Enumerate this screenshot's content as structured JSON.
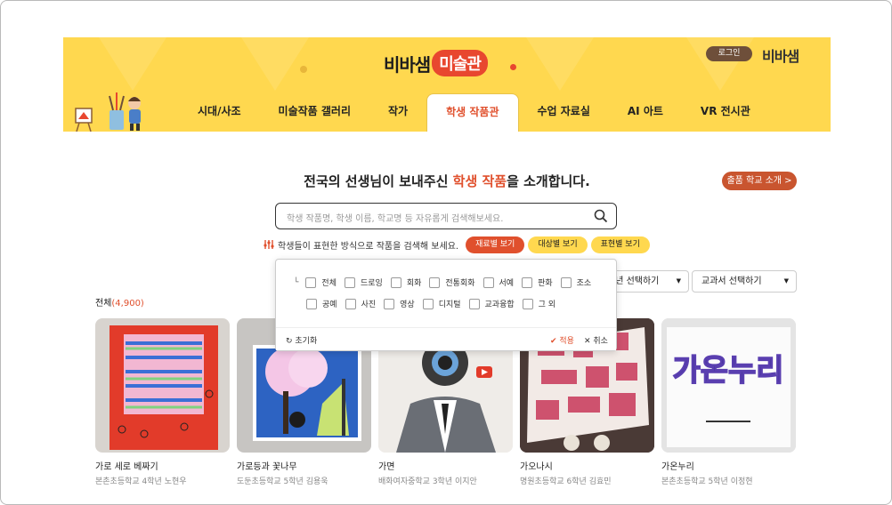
{
  "brand": {
    "logo_text": "비바샘",
    "logo_badge": "미술관",
    "right_logo": "비바샘",
    "login": "로그인"
  },
  "nav": [
    {
      "label": "시대/사조",
      "active": false
    },
    {
      "label": "미술작품 갤러리",
      "active": false
    },
    {
      "label": "작가",
      "active": false
    },
    {
      "label": "학생 작품관",
      "active": true
    },
    {
      "label": "수업 자료실",
      "active": false
    },
    {
      "label": "AI 아트",
      "active": false
    },
    {
      "label": "VR 전시관",
      "active": false
    }
  ],
  "hero": {
    "title_pre": "전국의 선생님이 보내주신 ",
    "title_hl": "학생 작품",
    "title_post": "을 소개합니다.",
    "school_button": "출품 학교 소개 >"
  },
  "search": {
    "placeholder": "학생 작품명, 학생 이름, 학교명 등 자유롭게 검색해보세요.",
    "icon": "search-icon"
  },
  "filter": {
    "description": "학생들이 표현한 방식으로 작품을 검색해 보세요.",
    "pills": [
      {
        "label": "재료별 보기",
        "active": true
      },
      {
        "label": "대상별 보기",
        "active": false
      },
      {
        "label": "표현별 보기",
        "active": false
      }
    ]
  },
  "dropdown": {
    "row1": [
      "전체",
      "드로잉",
      "회화",
      "전통회화",
      "서예",
      "판화",
      "조소"
    ],
    "row2": [
      "공예",
      "사진",
      "영상",
      "디지털",
      "교과융합",
      "그 외"
    ],
    "reset": "초기화",
    "apply": "✔ 적용",
    "cancel": "✕ 취소"
  },
  "selects": {
    "grade": "학년 선택하기",
    "textbook": "교과서 선택하기"
  },
  "total": {
    "label": "전체",
    "count": "(4,900)"
  },
  "artworks": [
    {
      "title": "가로 세로 베짜기",
      "sub": "본촌초등학교 4학년 노현우"
    },
    {
      "title": "가로등과 꽃나무",
      "sub": "도둔초등학교 5학년 김용욱"
    },
    {
      "title": "가면",
      "sub": "배화여자중학교 3학년 이지안"
    },
    {
      "title": "가오나시",
      "sub": "명원초등학교 6학년 김효민"
    },
    {
      "title": "가온누리",
      "sub": "본촌초등학교 5학년 이정현",
      "art_text": "가온누리"
    }
  ],
  "colors": {
    "accent": "#e0502d",
    "header_bg": "#ffd84f",
    "login_bg": "#6e4f3a"
  }
}
